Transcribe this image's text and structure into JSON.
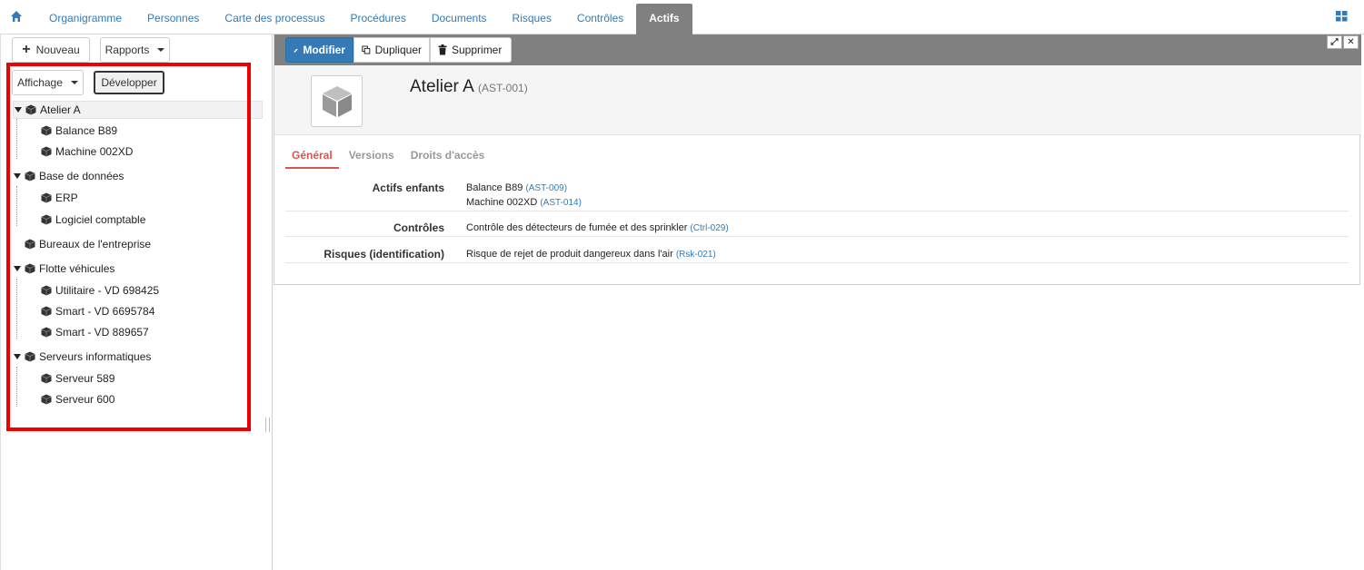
{
  "nav": {
    "home_icon": "home-icon",
    "tabs": [
      {
        "label": "Organigramme"
      },
      {
        "label": "Personnes"
      },
      {
        "label": "Carte des processus"
      },
      {
        "label": "Procédures"
      },
      {
        "label": "Documents"
      },
      {
        "label": "Risques"
      },
      {
        "label": "Contrôles"
      },
      {
        "label": "Actifs",
        "active": true
      }
    ],
    "apps_icon": "grid-apps-icon"
  },
  "left": {
    "new_label": "Nouveau",
    "reports_label": "Rapports",
    "display_label": "Affichage",
    "expand_label": "Développer",
    "tree": [
      {
        "label": "Atelier A",
        "children": [
          "Balance B89",
          "Machine 002XD"
        ]
      },
      {
        "label": "Base de données",
        "children": [
          "ERP",
          "Logiciel comptable"
        ]
      },
      {
        "label": "Bureaux de l'entreprise",
        "children": []
      },
      {
        "label": "Flotte véhicules",
        "children": [
          "Utilitaire - VD 698425",
          "Smart - VD 6695784",
          "Smart - VD 889657"
        ]
      },
      {
        "label": "Serveurs informatiques",
        "children": [
          "Serveur 589",
          "Serveur 600"
        ]
      }
    ]
  },
  "toolbar": {
    "edit_label": "Modifier",
    "duplicate_label": "Dupliquer",
    "delete_label": "Supprimer"
  },
  "record": {
    "name": "Atelier A",
    "code": "(AST-001)"
  },
  "subtabs": [
    "Général",
    "Versions",
    "Droits d'accès"
  ],
  "fields": {
    "children_label": "Actifs enfants",
    "children": [
      {
        "name": "Balance B89",
        "ref": "(AST-009)"
      },
      {
        "name": "Machine 002XD",
        "ref": "(AST-014)"
      }
    ],
    "controls_label": "Contrôles",
    "controls": [
      {
        "name": "Contrôle des détecteurs de fumée et des sprinkler",
        "ref": "(Ctrl-029)"
      }
    ],
    "risks_label": "Risques (identification)",
    "risks": [
      {
        "name": "Risque de rejet de produit dangereux dans l'air",
        "ref": "(Rsk-021)"
      }
    ]
  },
  "colors": {
    "nav_link": "#337ab7",
    "active_tab_bg": "#808080",
    "primary_btn": "#337ab7",
    "active_subtab": "#d9534f",
    "highlight_border": "#ee0000"
  }
}
